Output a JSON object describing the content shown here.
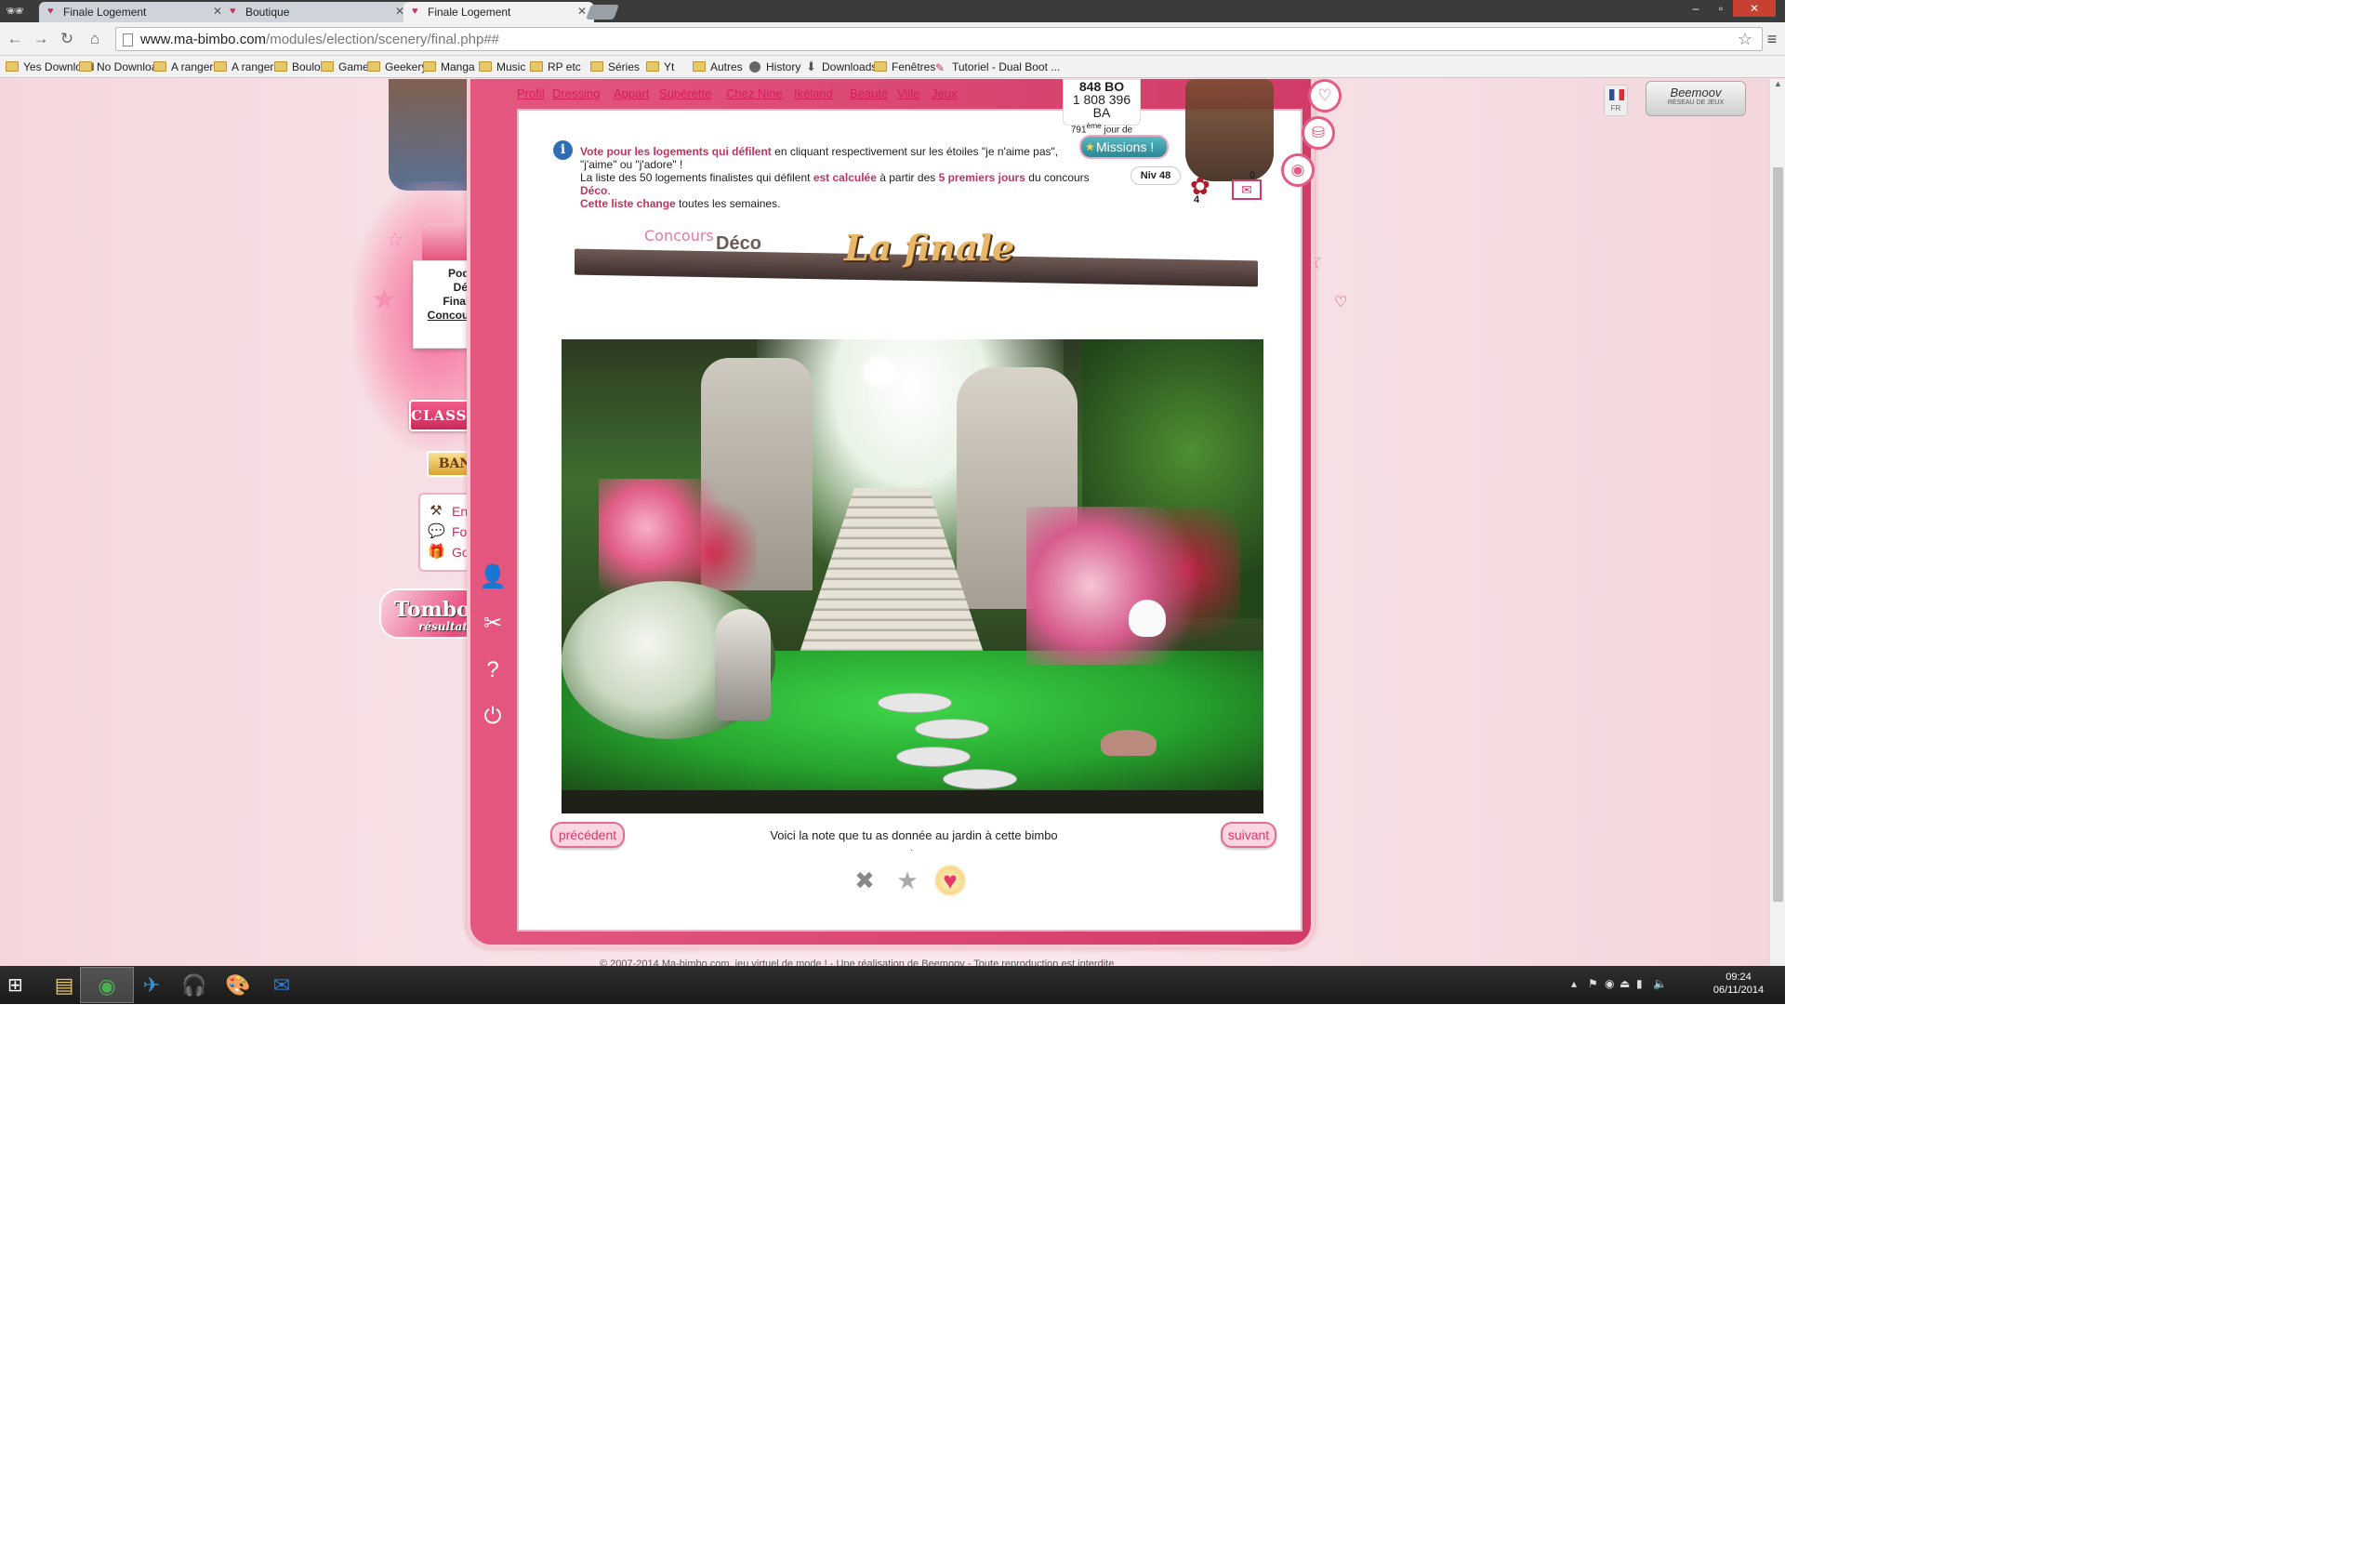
{
  "browser": {
    "tabs": [
      {
        "title": "Finale Logement",
        "active": false
      },
      {
        "title": "Boutique",
        "active": false
      },
      {
        "title": "Finale Logement",
        "active": true
      }
    ],
    "url_host": "www.ma-bimbo.com",
    "url_path": "/modules/election/scenery/final.php##",
    "bookmarks": [
      {
        "label": "Yes Download",
        "icon": "folder-icon"
      },
      {
        "label": "No Download",
        "icon": "folder-icon"
      },
      {
        "label": "A ranger 1",
        "icon": "folder-icon"
      },
      {
        "label": "A ranger 2",
        "icon": "folder-icon"
      },
      {
        "label": "Boulot",
        "icon": "folder-icon"
      },
      {
        "label": "Games",
        "icon": "folder-icon"
      },
      {
        "label": "Geekery",
        "icon": "folder-icon"
      },
      {
        "label": "Manga",
        "icon": "folder-icon"
      },
      {
        "label": "Music",
        "icon": "folder-icon"
      },
      {
        "label": "RP etc",
        "icon": "folder-icon"
      },
      {
        "label": "Séries",
        "icon": "folder-icon"
      },
      {
        "label": "Yt",
        "icon": "folder-icon"
      },
      {
        "label": "Autres",
        "icon": "folder-icon"
      },
      {
        "label": "History",
        "icon": "globe-icon"
      },
      {
        "label": "Downloads",
        "icon": "download-icon"
      },
      {
        "label": "Fenêtres",
        "icon": "folder-icon"
      },
      {
        "label": "Tutoriel - Dual Boot ...",
        "icon": "page-icon"
      }
    ]
  },
  "nav": {
    "links": [
      "Profil",
      "Dressing",
      "Appart",
      "Supérette",
      "Chez Nine",
      "Ikéland",
      "Beauté",
      "Ville",
      "Jeux"
    ]
  },
  "sidebar": {
    "podium_items": [
      "Podium",
      "Défilé",
      "Finalistes",
      "Concours Déco"
    ],
    "classement": "CLASSEMENT",
    "banque": "BANQUE",
    "links": [
      {
        "label": "Enchères",
        "icon": "gavel-icon"
      },
      {
        "label": "Forum",
        "icon": "speech-bubble-icon"
      },
      {
        "label": "Goodies",
        "icon": "gift-icon"
      }
    ],
    "tombola": "Tombola",
    "tombola_sub": "résultats !",
    "icons": [
      "profile-icon",
      "options-icon",
      "help-icon",
      "logout-icon"
    ]
  },
  "status": {
    "bo": "848 BO",
    "ba": "1 808 396 BA",
    "day_number": "791",
    "day_suffix": "ème",
    "day_label": "jour de jeu",
    "missions": "Missions !",
    "level": "Niv 48",
    "gifts": "4",
    "mails": "0",
    "lang": "FR",
    "beemoov": "Beemoov",
    "beemoov_sub": "RÉSEAU DE JEUX"
  },
  "info": {
    "p1_hl": "Vote pour les logements qui défilent",
    "p1_rest": " en cliquant respectivement sur les étoiles \"je n'aime pas\", \"j'aime\" ou \"j'adore\" !",
    "p2_a": "La liste des 50 logements finalistes qui défilent ",
    "p2_hl1": "est calculée",
    "p2_b": " à partir des ",
    "p2_hl2": "5 premiers jours",
    "p2_c": " du concours ",
    "p2_hl3": "Déco",
    "p2_d": ".",
    "p3_hl": "Cette liste change",
    "p3_rest": " toutes les semaines."
  },
  "banner": {
    "concours": "Concours",
    "deco": "Déco",
    "finale": "La finale"
  },
  "voting": {
    "prev": "précédent",
    "next": "suivant",
    "note_text": "Voici la note que tu as donnée au jardin à cette bimbo",
    "note_dot": ".",
    "options": [
      "je n'aime pas",
      "j'aime",
      "j'adore"
    ],
    "selected": "j'adore"
  },
  "footer": "© 2007-2014 Ma-bimbo.com, jeu virtuel de mode ! - Une réalisation de Beemoov - Toute reproduction est interdite",
  "taskbar": {
    "apps": [
      "file-explorer-icon",
      "chrome-icon",
      "thunderbird-icon",
      "music-player-icon",
      "paint-icon",
      "mail-icon"
    ],
    "time": "09:24",
    "date": "06/11/2014"
  },
  "colors": {
    "accent": "#d23b67",
    "link": "#d21f5e",
    "page_bg": "#f7dfe3"
  }
}
